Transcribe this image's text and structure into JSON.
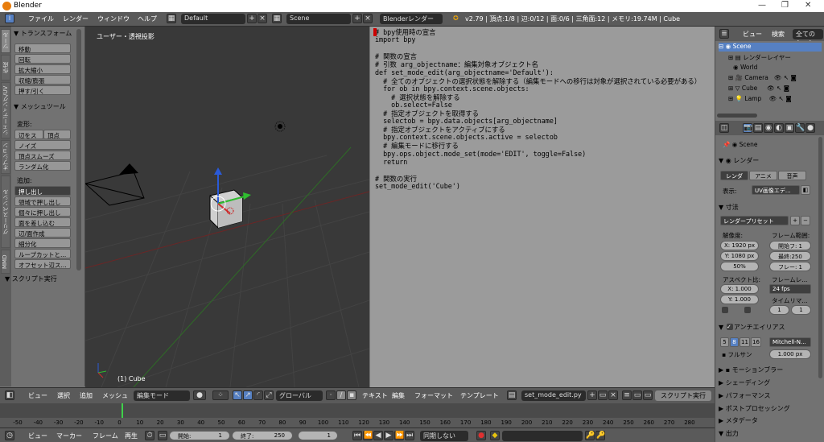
{
  "window": {
    "title": "Blender",
    "min": "—",
    "max": "❐",
    "close": "✕"
  },
  "topbar": {
    "menus": [
      "ファイル",
      "レンダー",
      "ウィンドウ",
      "ヘルプ"
    ],
    "layout": "Default",
    "scene": "Scene",
    "engine": "Blenderレンダー",
    "stats": "v2.79 | 頂点:1/8 | 辺:0/12 | 面:0/6 | 三角面:12 | メモリ:19.74M | Cube"
  },
  "toolshelf": {
    "tabs": [
      "ツール",
      "作成",
      "シェーディング/UV",
      "オプション",
      "グリースペンシル",
      "MMD"
    ],
    "transform": {
      "header": "トランスフォーム",
      "items": [
        "移動",
        "回転",
        "拡大縮小",
        "収縮/膨張",
        "押す/引く"
      ]
    },
    "mesh": {
      "header": "メッシュツール",
      "deform_label": "変形:",
      "deform_items": [
        "辺をス",
        "頂点",
        "ノイズ",
        "頂点スムーズ",
        "ランダム化"
      ],
      "add_label": "追加:",
      "add_items": [
        "押し出し",
        "領域で押し出し",
        "個々に押し出し",
        "面を差し込む",
        "辺/面作成",
        "細分化",
        "ループカットと...",
        "オフセット辺ス..."
      ]
    },
    "script": {
      "header": "スクリプト実行"
    }
  },
  "viewport": {
    "label": "ユーザー・透視投影",
    "object_label": "(1) Cube",
    "header": {
      "menus": [
        "ビュー",
        "選択",
        "追加",
        "メッシュ"
      ],
      "mode": "編集モード",
      "orientation": "グローバル"
    }
  },
  "text_editor": {
    "lines": [
      "# bpy使用時の宣言",
      "import bpy",
      "",
      "# 関数の宣言",
      "# 引数 arg_objectname：編集対象オブジェクト名",
      "def set_mode_edit(arg_objectname='Default'):",
      "  # 全てのオブジェクトの選択状態を解除する（編集モードへの移行は対象が選択されている必要がある）",
      "  for ob in bpy.context.scene.objects:",
      "    # 選択状態を解除する",
      "    ob.select=False",
      "  # 指定オブジェクトを取得する",
      "  selectob = bpy.data.objects[arg_objectname]",
      "  # 指定オブジェクトをアクティブにする",
      "  bpy.context.scene.objects.active = selectob",
      "  # 編集モードに移行する",
      "  bpy.ops.object.mode_set(mode='EDIT', toggle=False)",
      "  return",
      "",
      "# 関数の実行",
      "set_mode_edit('Cube')"
    ],
    "header": {
      "menus": [
        "テキスト",
        "編集",
        "フォーマット",
        "テンプレート"
      ],
      "filename": "set_mode_edit.py",
      "run_button": "スクリプト実行"
    }
  },
  "outliner": {
    "header": {
      "view": "ビュー",
      "search": "検索",
      "filter": "全てのシーン"
    },
    "items": [
      {
        "label": "Scene",
        "indent": 0
      },
      {
        "label": "レンダーレイヤー",
        "indent": 1
      },
      {
        "label": "World",
        "indent": 1
      },
      {
        "label": "Camera",
        "indent": 1
      },
      {
        "label": "Cube",
        "indent": 1
      },
      {
        "label": "Lamp",
        "indent": 1
      }
    ]
  },
  "properties": {
    "context": "Scene",
    "render": {
      "header": "レンダー",
      "buttons": [
        "レンダ",
        "アニメ",
        "音声"
      ],
      "display_label": "表示:",
      "display_value": "UV画像エデ..."
    },
    "dimensions": {
      "header": "寸法",
      "preset": "レンダープリセット",
      "resolution_label": "解像度:",
      "res_x": "X: 1920 px",
      "res_y": "Y: 1080 px",
      "res_pct": "50%",
      "frame_range_label": "フレーム範囲:",
      "start": "開始フ: 1",
      "end": "最終:250",
      "step": "フレー: 1",
      "aspect_label": "アスペクト比:",
      "aspect_x": "X: 1.000",
      "aspect_y": "Y: 1.000",
      "framerate_label": "フレームレ...",
      "fps": "24 fps",
      "timemap_label": "タイムリマ...",
      "tm_old": "1",
      "tm_new": "1"
    },
    "antialiasing": {
      "header": "アンチエイリアス",
      "samples": [
        "5",
        "8",
        "11",
        "16"
      ],
      "filter": "Mitchell-N...",
      "full_sample": "フルサン",
      "size": "1.000 px"
    },
    "collapsed": [
      "モーションブラー",
      "シェーディング",
      "パフォーマンス",
      "ポストプロセッシング",
      "メタデータ",
      "出力"
    ]
  },
  "timeline": {
    "ticks": [
      "-50",
      "-40",
      "-30",
      "-20",
      "-10",
      "0",
      "10",
      "20",
      "30",
      "40",
      "50",
      "60",
      "70",
      "80",
      "90",
      "100",
      "110",
      "120",
      "130",
      "140",
      "150",
      "160",
      "170",
      "180",
      "190",
      "200",
      "210",
      "220",
      "230",
      "240",
      "250",
      "260",
      "270",
      "280"
    ],
    "current_frame_value": 1,
    "header": {
      "menus": [
        "ビュー",
        "マーカー",
        "フレーム",
        "再生"
      ],
      "start": "開始:",
      "start_val": "1",
      "end": "終了:",
      "end_val": "250",
      "current": "1",
      "sync": "同期しない"
    }
  },
  "colors": {
    "accent": "#e87d0d",
    "active_btn": "#5680c2",
    "code_bg": "#9b9b9b",
    "viewport_bg": "#393939"
  }
}
